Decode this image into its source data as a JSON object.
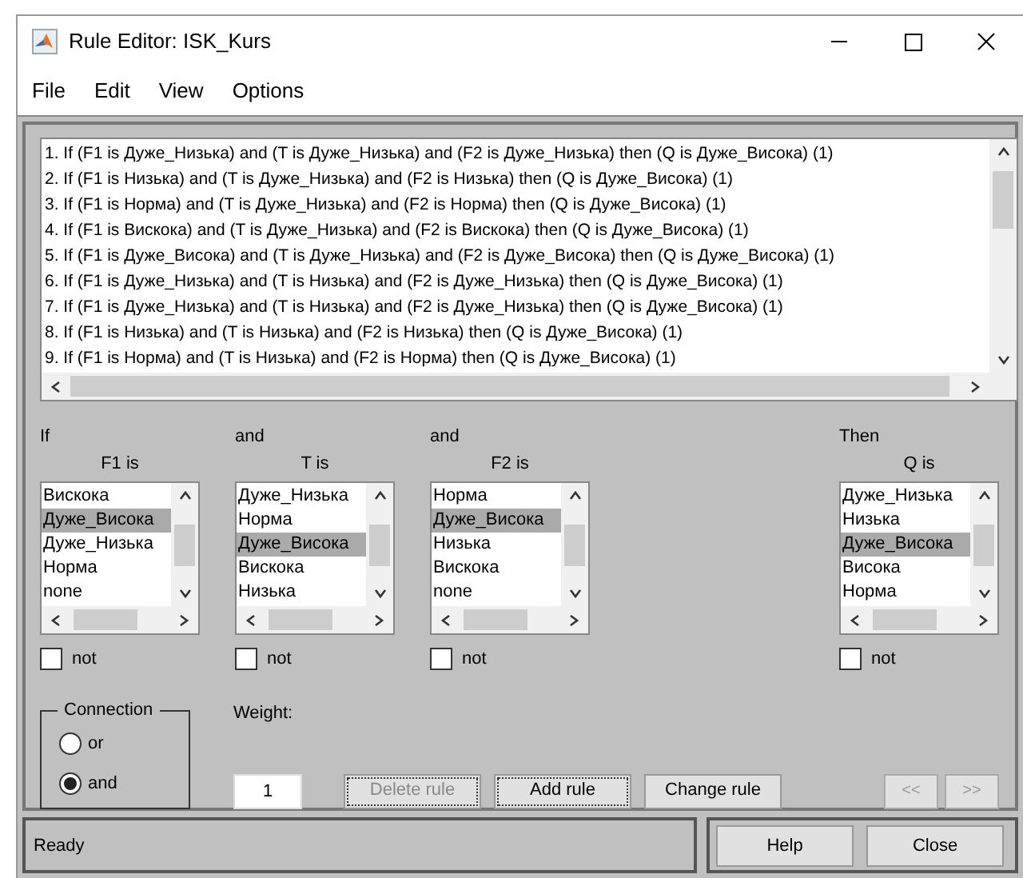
{
  "window": {
    "title": "Rule Editor: ISK_Kurs"
  },
  "menu": [
    "File",
    "Edit",
    "View",
    "Options"
  ],
  "rules": [
    "1. If (F1 is Дуже_Низька) and (T is Дуже_Низька) and (F2 is Дуже_Низька) then (Q is Дуже_Висока) (1)",
    "2. If (F1 is Низька) and (T is Дуже_Низька) and (F2 is Низька) then (Q is Дуже_Висока) (1)",
    "3. If (F1 is Норма) and (T is Дуже_Низька) and (F2 is Норма) then (Q is Дуже_Висока) (1)",
    "4. If (F1 is Вискока) and (T is Дуже_Низька) and (F2 is Вискока) then (Q is Дуже_Висока) (1)",
    "5. If (F1 is Дуже_Висока) and (T is Дуже_Низька) and (F2 is Дуже_Висока) then (Q is Дуже_Висока) (1)",
    "6. If (F1 is Дуже_Низька) and (T is Низька) and (F2 is Дуже_Низька) then (Q is Дуже_Висока) (1)",
    "7. If (F1 is Дуже_Низька) and (T is Низька) and (F2 is Дуже_Низька) then (Q is Дуже_Висока) (1)",
    "8. If (F1 is Низька) and (T is Низька) and (F2 is Низька) then (Q is Дуже_Висока) (1)",
    "9. If (F1 is Норма) and (T is Низька) and (F2 is Норма) then (Q is Дуже_Висока) (1)"
  ],
  "variables": [
    {
      "connector": "If",
      "label": "F1 is",
      "items": [
        {
          "text": "Вискока",
          "selected": false
        },
        {
          "text": "Дуже_Висока",
          "selected": true
        },
        {
          "text": "Дуже_Низька",
          "selected": false
        },
        {
          "text": "Норма",
          "selected": false
        },
        {
          "text": "none",
          "selected": false
        }
      ],
      "not_label": "not",
      "not_checked": false
    },
    {
      "connector": "and",
      "label": "T is",
      "items": [
        {
          "text": "Дуже_Низька",
          "selected": false
        },
        {
          "text": "Норма",
          "selected": false
        },
        {
          "text": "Дуже_Висока",
          "selected": true
        },
        {
          "text": "Вискока",
          "selected": false
        },
        {
          "text": "Низька",
          "selected": false
        }
      ],
      "not_label": "not",
      "not_checked": false
    },
    {
      "connector": "and",
      "label": "F2 is",
      "items": [
        {
          "text": "Норма",
          "selected": false
        },
        {
          "text": "Дуже_Висока",
          "selected": true
        },
        {
          "text": "Низька",
          "selected": false
        },
        {
          "text": "Вискока",
          "selected": false
        },
        {
          "text": "none",
          "selected": false
        }
      ],
      "not_label": "not",
      "not_checked": false
    },
    {
      "connector": "Then",
      "label": "Q is",
      "items": [
        {
          "text": "Дуже_Низька",
          "selected": false
        },
        {
          "text": "Низька",
          "selected": false
        },
        {
          "text": "Дуже_Висока",
          "selected": true
        },
        {
          "text": "Висока",
          "selected": false
        },
        {
          "text": "Норма",
          "selected": false
        }
      ],
      "not_label": "not",
      "not_checked": false
    }
  ],
  "connection": {
    "title": "Connection",
    "options": [
      {
        "label": "or",
        "selected": false
      },
      {
        "label": "and",
        "selected": true
      }
    ]
  },
  "weight": {
    "label": "Weight:",
    "value": "1"
  },
  "actions": [
    {
      "label": "Delete rule",
      "disabled": true,
      "focused": true
    },
    {
      "label": "Add rule",
      "disabled": false,
      "focused": true
    },
    {
      "label": "Change rule",
      "disabled": false,
      "focused": false
    }
  ],
  "nav": [
    {
      "label": "<<",
      "disabled": true
    },
    {
      "label": ">>",
      "disabled": true
    }
  ],
  "status": "Ready",
  "footer_buttons": [
    "Help",
    "Close"
  ]
}
